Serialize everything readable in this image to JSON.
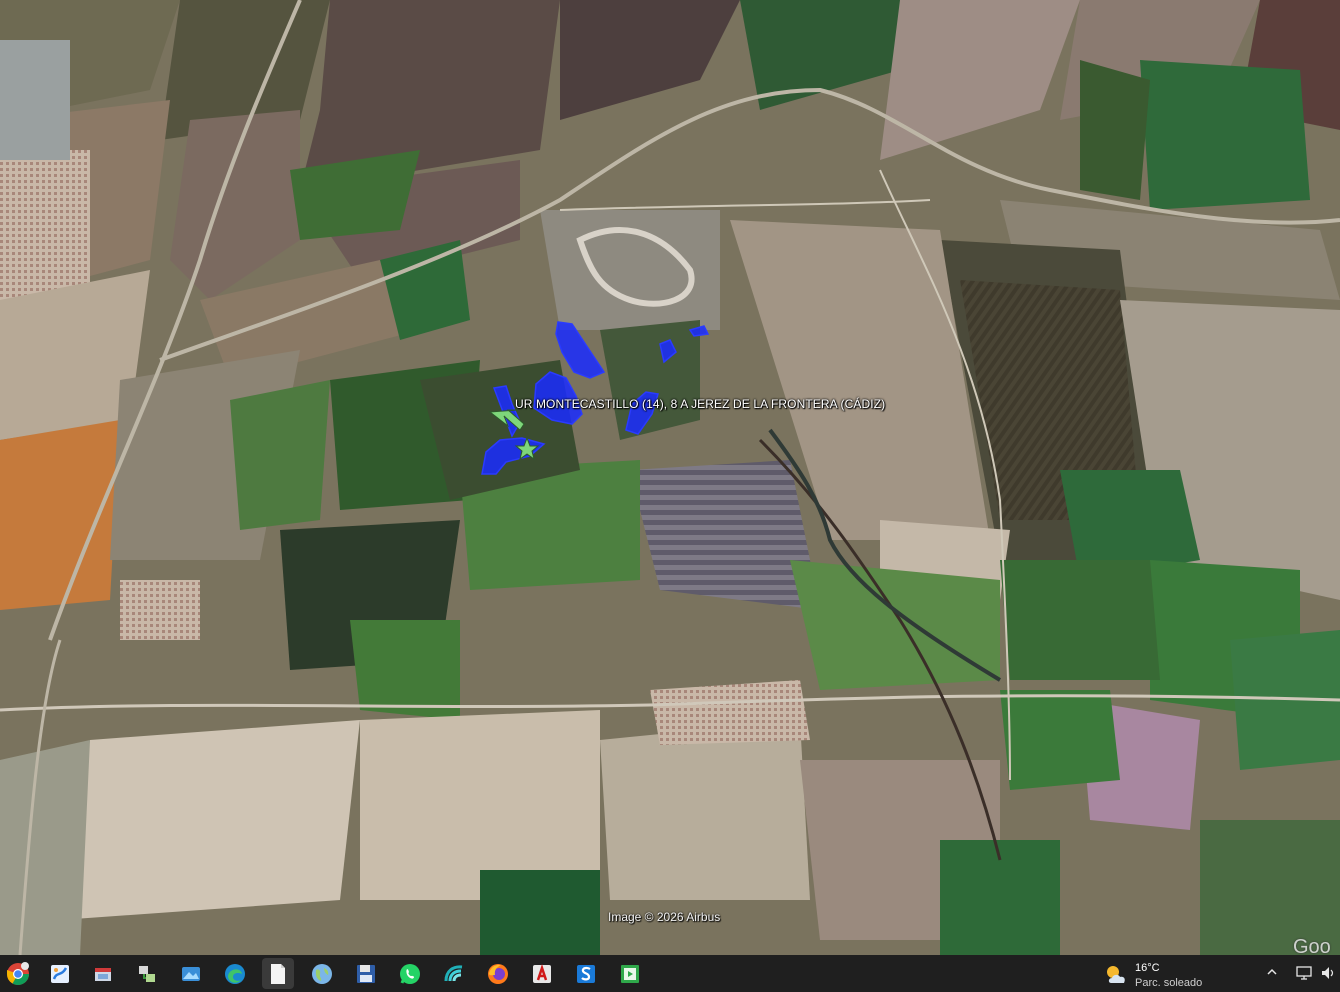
{
  "map": {
    "placemark_label": "UR MONTECASTILLO (14), 8 A JEREZ DE LA FRONTERA (CÁDIZ)",
    "attribution": "Image © 2026 Airbus",
    "google_mark": "Goo",
    "overlay_color": "#1a2bff",
    "marker_color": "#7ed67a"
  },
  "taskbar": {
    "apps": [
      {
        "name": "chrome-icon",
        "label": "Google Chrome",
        "badge": "16"
      },
      {
        "name": "paint-icon",
        "label": "Paint"
      },
      {
        "name": "window-switch-icon",
        "label": "App window"
      },
      {
        "name": "network-tool-icon",
        "label": "Network tool"
      },
      {
        "name": "photos-icon",
        "label": "Photos"
      },
      {
        "name": "edge-icon",
        "label": "Microsoft Edge"
      },
      {
        "name": "blank-file-icon",
        "label": "File"
      },
      {
        "name": "globe-icon",
        "label": "Google Earth"
      },
      {
        "name": "floppy-save-icon",
        "label": "Save"
      },
      {
        "name": "whatsapp-icon",
        "label": "WhatsApp"
      },
      {
        "name": "spiral-app-icon",
        "label": "App"
      },
      {
        "name": "firefox-icon",
        "label": "Firefox"
      },
      {
        "name": "acrobat-icon",
        "label": "Acrobat"
      },
      {
        "name": "s-app-icon",
        "label": "S app"
      },
      {
        "name": "video-player-icon",
        "label": "Media player"
      }
    ],
    "weather": {
      "temperature": "16°C",
      "description": "Parc. soleado"
    },
    "tray_icons": [
      "chevron-up-icon",
      "display-icon",
      "speaker-icon"
    ]
  }
}
